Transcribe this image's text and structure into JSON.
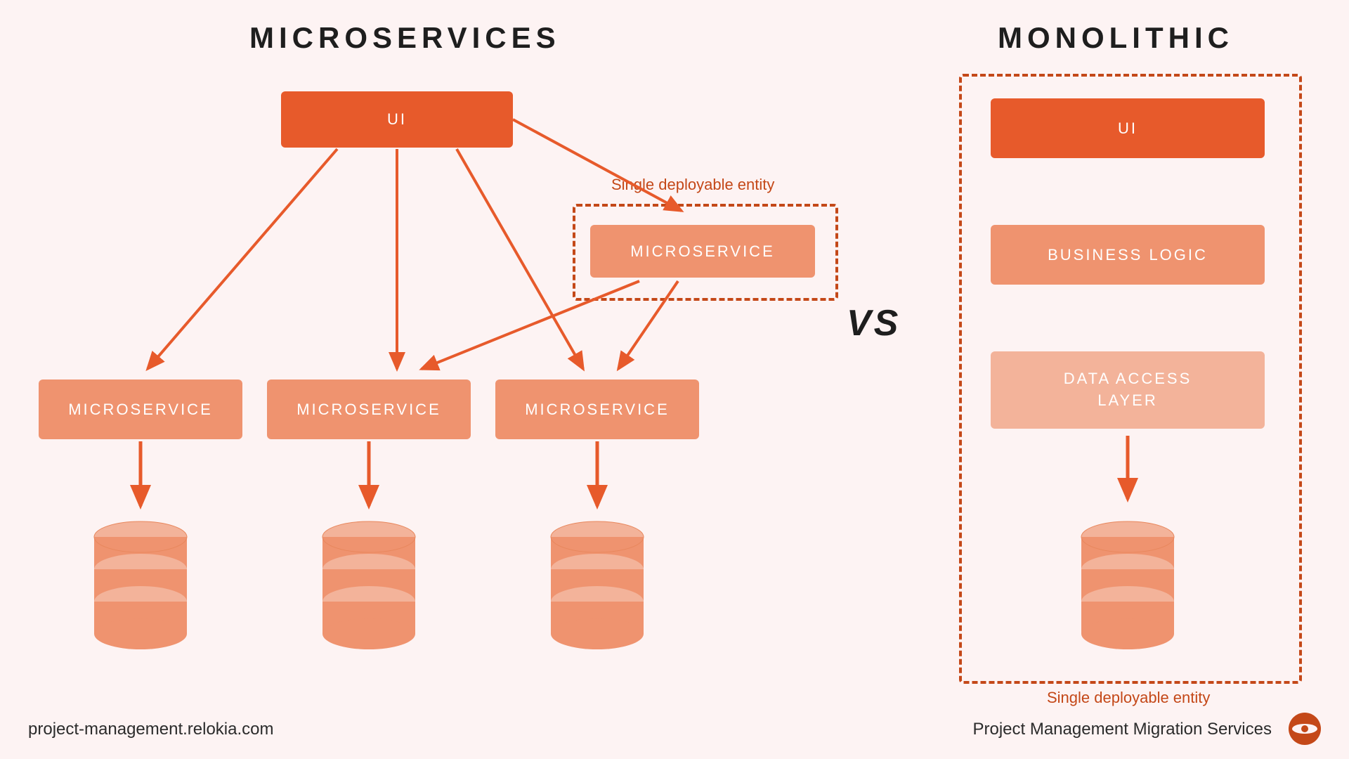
{
  "headings": {
    "left": "MICROSERVICES",
    "right": "MONOLITHIC",
    "vs": "VS"
  },
  "left": {
    "ui": "UI",
    "ms_top": "MICROSERVICE",
    "ms1": "MICROSERVICE",
    "ms2": "MICROSERVICE",
    "ms3": "MICROSERVICE",
    "deploy_caption": "Single deployable entity"
  },
  "right": {
    "ui": "UI",
    "logic": "BUSINESS LOGIC",
    "data": "DATA ACCESS LAYER",
    "deploy_caption": "Single deployable entity"
  },
  "footer": {
    "url": "project-management.relokia.com",
    "brand": "Project Management Migration Services"
  },
  "colors": {
    "arrow": "#e75a2b",
    "dash": "#c44818"
  }
}
